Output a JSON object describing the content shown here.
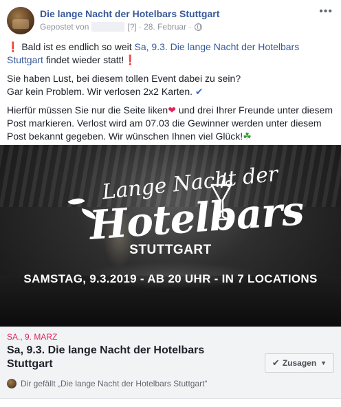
{
  "post": {
    "page_name": "Die lange Nacht der Hotelbars Stuttgart",
    "posted_by_prefix": "Gepostet von",
    "posted_by_marker": "[?]",
    "date": "· 28. Februar ·",
    "more_icon": "more-icon",
    "lines": {
      "p1_exclaim": "❗",
      "p1_text": "Bald ist es endlich so weit",
      "p1_link": "Sa, 9.3. Die lange Nacht der Hotelbars Stuttgart",
      "p1_tail": "findet wieder statt!",
      "p1_exclaim2": "❗",
      "p2_line1": "Sie haben Lust, bei diesem tollen Event dabei zu sein?",
      "p2_line2": "Gar kein Problem. Wir verlosen 2x2 Karten.",
      "p2_check": "✔",
      "p3_a": "Hierfür müssen Sie nur die Seite liken",
      "p3_heart": "❤",
      "p3_b": "und drei Ihrer Freunde unter diesem Post markieren. Verlost wird am 07.03 die Gewinner werden unter diesem Post bekannt gegeben. Wir wünschen Ihnen viel Glück!",
      "p3_clover": "☘"
    }
  },
  "banner": {
    "logo_line1": "Lange Nacht der",
    "logo_line2": "Hotelbars",
    "city": "STUTTGART",
    "date_line": "SAMSTAG, 9.3.2019 - AB 20 UHR - IN 7 LOCATIONS"
  },
  "event": {
    "date": "SA., 9. MARZ",
    "title": "Sa, 9.3. Die lange Nacht der Hotelbars Stuttgart",
    "join_label": "Zusagen",
    "like_text": "Dir gefällt „Die lange Nacht der Hotelbars Stuttgart“"
  }
}
